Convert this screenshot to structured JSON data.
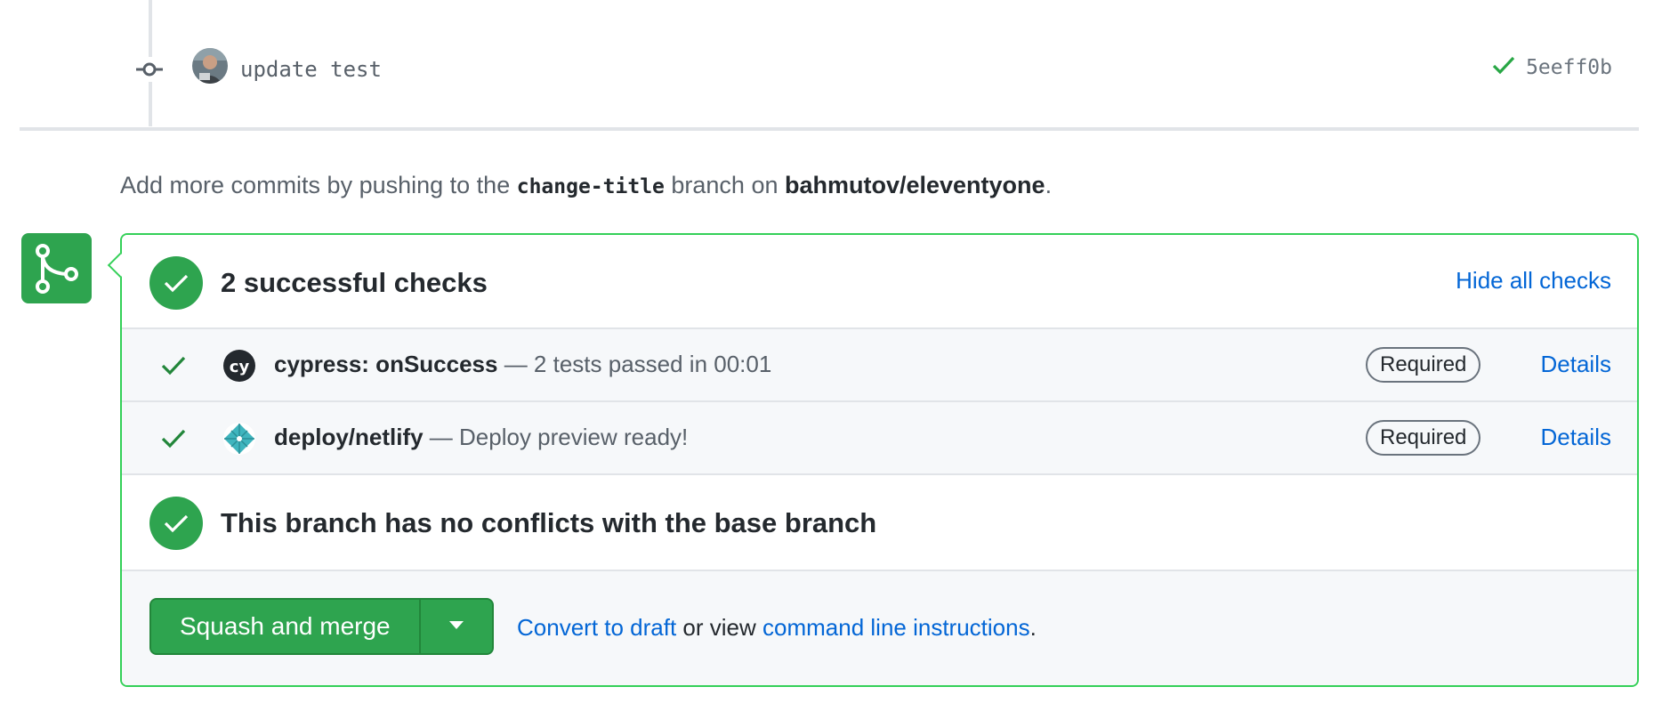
{
  "commit": {
    "message": "update test",
    "sha": "5eeff0b"
  },
  "push_hint": {
    "prefix": "Add more commits by pushing to the ",
    "branch": "change-title",
    "middle": " branch on ",
    "repo": "bahmutov/eleventyone",
    "suffix": "."
  },
  "checks": {
    "title": "2 successful checks",
    "hide_label": "Hide all checks",
    "items": [
      {
        "context": "cypress: onSuccess",
        "description": " — 2 tests passed in 00:01",
        "badge": "Required",
        "details": "Details",
        "logo_text": "cy"
      },
      {
        "context": "deploy/netlify",
        "description": " — Deploy preview ready!",
        "badge": "Required",
        "details": "Details"
      }
    ]
  },
  "conflicts": {
    "title": "This branch has no conflicts with the base branch"
  },
  "merge": {
    "button_label": "Squash and merge",
    "link_draft": "Convert to draft",
    "link_middle": " or view ",
    "link_cli": "command line instructions",
    "link_suffix": "."
  },
  "colors": {
    "success": "#2ea44f",
    "link": "#0366d6",
    "border_success": "#34d058"
  }
}
